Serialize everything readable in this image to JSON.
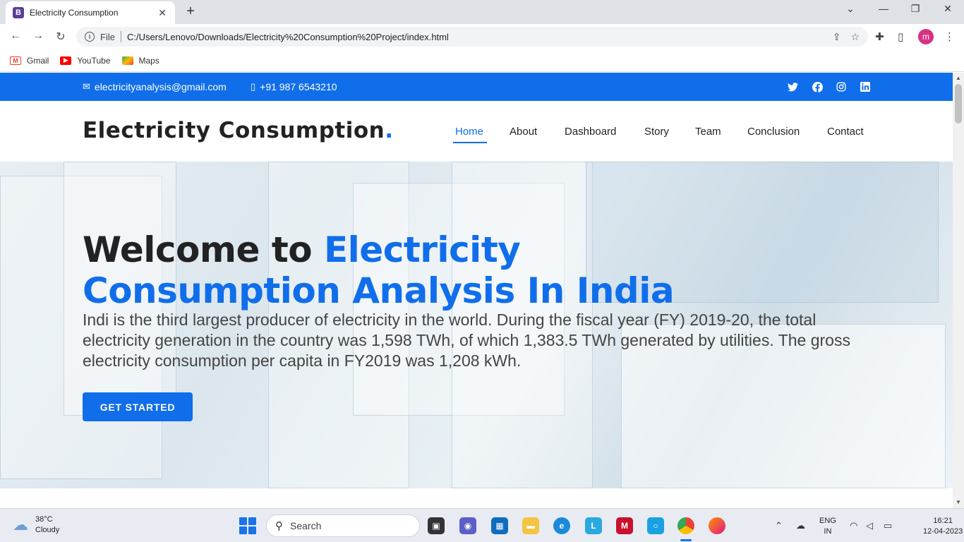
{
  "browser": {
    "tab_title": "Electricity Consumption",
    "tab_favicon_letter": "B",
    "url_scheme": "File",
    "url": "C:/Users/Lenovo/Downloads/Electricity%20Consumption%20Project/index.html",
    "profile_initial": "m",
    "bookmarks": [
      {
        "label": "Gmail",
        "icon": "gmail-icon"
      },
      {
        "label": "YouTube",
        "icon": "youtube-icon"
      },
      {
        "label": "Maps",
        "icon": "maps-icon"
      }
    ]
  },
  "topbar": {
    "email": "electricityanalysis@gmail.com",
    "phone": "+91 987 6543210",
    "social": [
      "twitter-icon",
      "facebook-icon",
      "instagram-icon",
      "linkedin-icon"
    ]
  },
  "header": {
    "logo_text": "Electricity Consumption",
    "logo_dot": ".",
    "nav": [
      {
        "label": "Home",
        "active": true
      },
      {
        "label": "About"
      },
      {
        "label": "Dashboard"
      },
      {
        "label": "Story"
      },
      {
        "label": "Team"
      },
      {
        "label": "Conclusion"
      },
      {
        "label": "Contact"
      }
    ]
  },
  "hero": {
    "title_prefix": "Welcome to ",
    "title_highlight": "Electricity Consumption Analysis In India",
    "description": "Indi is the third largest producer of electricity in the world. During the fiscal year (FY) 2019-20, the total electricity generation in the country was 1,598 TWh, of which 1,383.5 TWh generated by utilities. The gross electricity consumption per capita in FY2019 was 1,208 kWh.",
    "cta_label": "GET STARTED"
  },
  "taskbar": {
    "temperature": "38°C",
    "condition": "Cloudy",
    "search_label": "Search",
    "language_line1": "ENG",
    "language_line2": "IN",
    "time": "16:21",
    "date": "12-04-2023"
  },
  "colors": {
    "accent": "#106eea",
    "text_dark": "#222222"
  }
}
